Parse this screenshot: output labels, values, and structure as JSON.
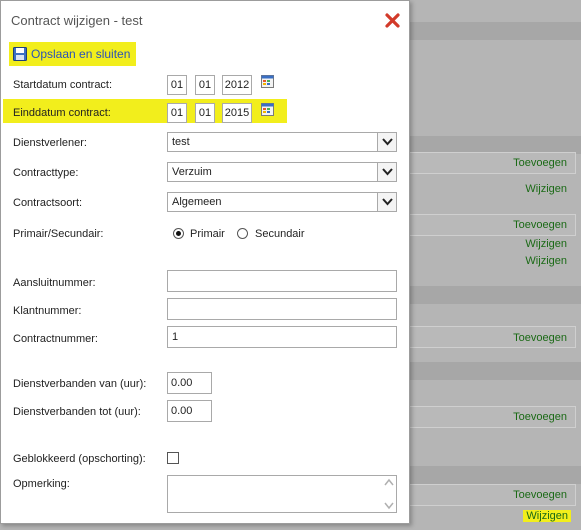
{
  "dialog": {
    "title": "Contract wijzigen - test",
    "save_label": "Opslaan en sluiten"
  },
  "fields": {
    "start_label": "Startdatum contract:",
    "start_day": "01",
    "start_month": "01",
    "start_year": "2012",
    "end_label": "Einddatum contract:",
    "end_day": "01",
    "end_month": "01",
    "end_year": "2015",
    "provider_label": "Dienstverlener:",
    "provider_value": "test",
    "type_label": "Contracttype:",
    "type_value": "Verzuim",
    "kind_label": "Contractsoort:",
    "kind_value": "Algemeen",
    "primsec_label": "Primair/Secundair:",
    "primary_label": "Primair",
    "secondary_label": "Secundair",
    "connection_label": "Aansluitnummer:",
    "connection_value": "",
    "customer_label": "Klantnummer:",
    "customer_value": "",
    "contract_no_label": "Contractnummer:",
    "contract_no_value": "1",
    "emp_from_label": "Dienstverbanden van (uur):",
    "emp_from_value": "0.00",
    "emp_to_label": "Dienstverbanden tot (uur):",
    "emp_to_value": "0.00",
    "blocked_label": "Geblokkeerd (opschorting):",
    "remark_label": "Opmerking:"
  },
  "background": {
    "add": "Toevoegen",
    "edit": "Wijzigen"
  },
  "colors": {
    "highlight": "#f2ee1c",
    "link_green": "#1b6a16",
    "save_blue": "#2a52b8",
    "close_red": "#d23a2a"
  }
}
